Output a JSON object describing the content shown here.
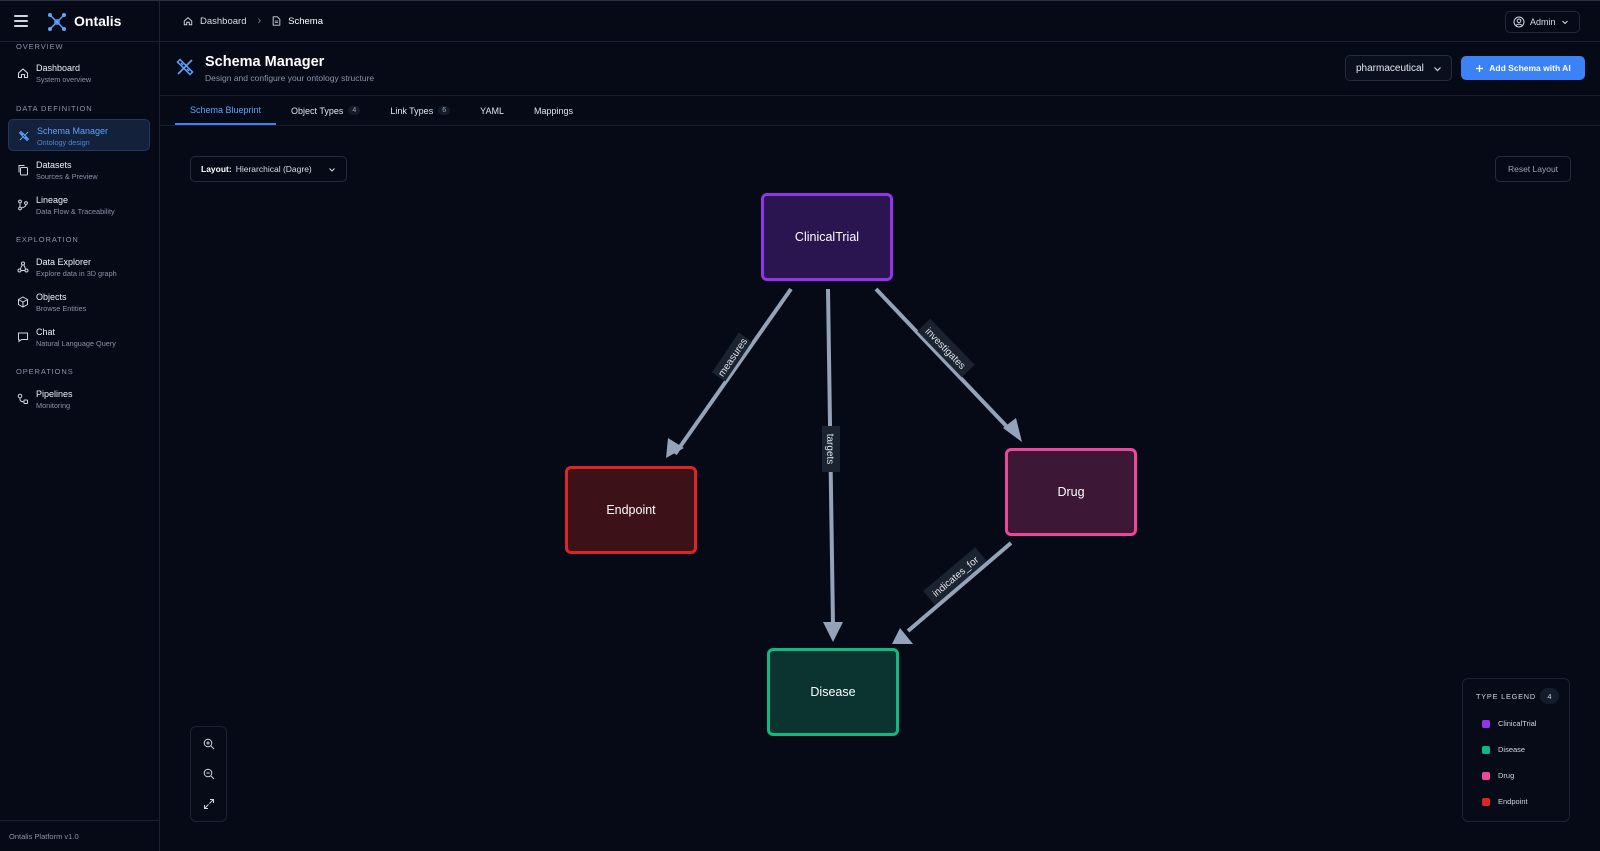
{
  "app": {
    "name": "Ontalis",
    "version": "Ontalis Platform v1.0"
  },
  "breadcrumb": {
    "home": "Dashboard",
    "current": "Schema"
  },
  "user": {
    "label": "Admin"
  },
  "sidebar": {
    "sections": [
      {
        "title": "OVERVIEW"
      },
      {
        "title": "DATA DEFINITION"
      },
      {
        "title": "EXPLORATION"
      },
      {
        "title": "OPERATIONS"
      }
    ],
    "items": [
      {
        "title": "Dashboard",
        "sub": "System overview",
        "icon": "home-icon"
      },
      {
        "title": "Schema Manager",
        "sub": "Ontology design",
        "icon": "schema-icon",
        "active": true
      },
      {
        "title": "Datasets",
        "sub": "Sources & Preview",
        "icon": "copy-icon"
      },
      {
        "title": "Lineage",
        "sub": "Data Flow & Traceability",
        "icon": "git-branch-icon"
      },
      {
        "title": "Data Explorer",
        "sub": "Explore data in 3D graph",
        "icon": "network-icon"
      },
      {
        "title": "Objects",
        "sub": "Browse Entities",
        "icon": "cube-icon"
      },
      {
        "title": "Chat",
        "sub": "Natural Language Query",
        "icon": "chat-icon"
      },
      {
        "title": "Pipelines",
        "sub": "Monitoring",
        "icon": "pipeline-icon"
      }
    ]
  },
  "page": {
    "title": "Schema Manager",
    "subtitle": "Design and configure your ontology structure",
    "domain": "pharmaceutical",
    "add_button": "Add Schema with AI"
  },
  "tabs": [
    {
      "label": "Schema Blueprint",
      "active": true
    },
    {
      "label": "Object Types",
      "count": "4"
    },
    {
      "label": "Link Types",
      "count": "6"
    },
    {
      "label": "YAML"
    },
    {
      "label": "Mappings"
    }
  ],
  "canvas": {
    "layout_label": "Layout:",
    "layout_value": "Hierarchical (Dagre)",
    "reset_label": "Reset Layout"
  },
  "graph": {
    "nodes": [
      {
        "id": "ClinicalTrial",
        "label": "ClinicalTrial",
        "border": "#9333ea",
        "fill": "#2a1550"
      },
      {
        "id": "Endpoint",
        "label": "Endpoint",
        "border": "#dc2626",
        "fill": "#3d1118"
      },
      {
        "id": "Drug",
        "label": "Drug",
        "border": "#ec4899",
        "fill": "#3d1736"
      },
      {
        "id": "Disease",
        "label": "Disease",
        "border": "#10b981",
        "fill": "#0b3430"
      }
    ],
    "edges": [
      {
        "from": "ClinicalTrial",
        "to": "Endpoint",
        "label": "measures"
      },
      {
        "from": "ClinicalTrial",
        "to": "Disease",
        "label": "targets"
      },
      {
        "from": "ClinicalTrial",
        "to": "Drug",
        "label": "investigates"
      },
      {
        "from": "Drug",
        "to": "Disease",
        "label": "indicates_for"
      }
    ],
    "edge_color": "#94a3b8"
  },
  "legend": {
    "title": "TYPE LEGEND",
    "count": "4",
    "items": [
      {
        "label": "ClinicalTrial",
        "color": "#9333ea"
      },
      {
        "label": "Disease",
        "color": "#10b981"
      },
      {
        "label": "Drug",
        "color": "#ec4899"
      },
      {
        "label": "Endpoint",
        "color": "#dc2626"
      }
    ]
  }
}
